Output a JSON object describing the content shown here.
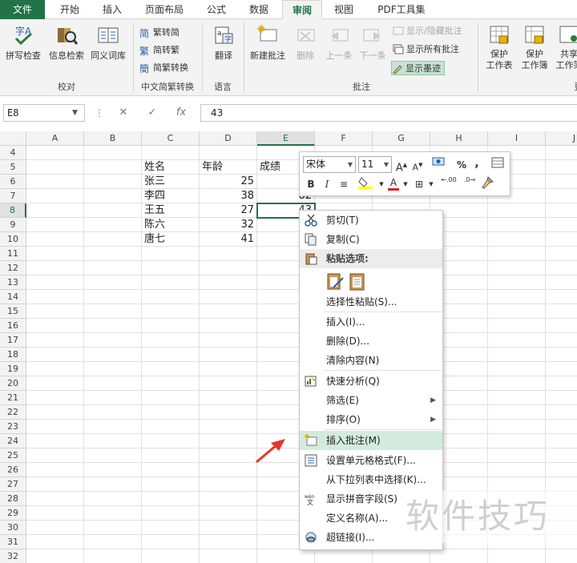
{
  "tabs": [
    "文件",
    "开始",
    "插入",
    "页面布局",
    "公式",
    "数据",
    "审阅",
    "视图",
    "PDF工具集"
  ],
  "active_tab": "审阅",
  "ribbon": {
    "proofing": {
      "spell": "拼写检查",
      "research": "信息检索",
      "thesaurus": "同义词库",
      "group": "校对"
    },
    "chinese": {
      "to_simplified": "繁转简",
      "to_traditional": "简转繁",
      "convert": "简繁转换",
      "group": "中文简繁转换"
    },
    "language": {
      "translate": "翻译",
      "group": "语言"
    },
    "comments": {
      "new": "新建批注",
      "delete": "删除",
      "prev": "上一条",
      "next": "下一条",
      "show_hide": "显示/隐藏批注",
      "show_all": "显示所有批注",
      "show_ink": "显示墨迹",
      "group": "批注"
    },
    "changes": {
      "protect_sheet_1": "保护",
      "protect_sheet_2": "工作表",
      "protect_book_1": "保护",
      "protect_book_2": "工作簿",
      "share_1": "共享",
      "share_2": "工作簿",
      "group": "更"
    }
  },
  "formula_bar": {
    "name_box": "E8",
    "value": "43",
    "fx": "fx"
  },
  "columns": [
    "A",
    "B",
    "C",
    "D",
    "E",
    "F",
    "G",
    "H",
    "I",
    "J"
  ],
  "rows": [
    "4",
    "5",
    "6",
    "7",
    "8",
    "9",
    "10",
    "11",
    "12",
    "13",
    "14",
    "15",
    "16",
    "17",
    "18",
    "19",
    "20",
    "21",
    "22",
    "23",
    "24",
    "25",
    "26",
    "27",
    "28",
    "29",
    "30",
    "31",
    "32"
  ],
  "table": {
    "header": {
      "name": "姓名",
      "age": "年龄",
      "score": "成绩"
    },
    "data": [
      {
        "name": "张三",
        "age": "25"
      },
      {
        "name": "李四",
        "age": "38",
        "score": "82"
      },
      {
        "name": "王五",
        "age": "27",
        "score": "43"
      },
      {
        "name": "陈六",
        "age": "32"
      },
      {
        "name": "唐七",
        "age": "41"
      }
    ]
  },
  "mini_toolbar": {
    "font": "宋体",
    "size": "11",
    "percent": "%",
    "comma": ",",
    "bold": "B",
    "italic": "I",
    "font_color": "A",
    "dec_inc": ".00",
    "dec_dec": ".0"
  },
  "context_menu": {
    "cut": "剪切(T)",
    "copy": "复制(C)",
    "paste_options": "粘贴选项:",
    "paste_special": "选择性粘贴(S)...",
    "insert": "插入(I)...",
    "delete": "删除(D)...",
    "clear": "清除内容(N)",
    "quick_analysis": "快速分析(Q)",
    "filter": "筛选(E)",
    "sort": "排序(O)",
    "insert_comment": "插入批注(M)",
    "format_cells": "设置单元格格式(F)...",
    "pick_list": "从下拉列表中选择(K)...",
    "phonetic": "显示拼音字段(S)",
    "define_name": "定义名称(A)...",
    "hyperlink": "超链接(I)..."
  },
  "watermark": "软件技巧",
  "colors": {
    "excel_green": "#217346",
    "highlight": "#d3ebdd",
    "arrow_red": "#e8352b"
  }
}
